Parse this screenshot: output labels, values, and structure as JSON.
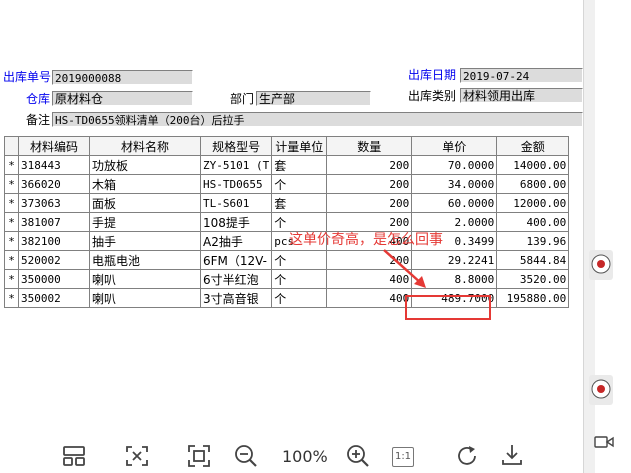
{
  "form": {
    "out_no_label": "出库单号",
    "out_no": "2019000088",
    "out_date_label": "出库日期",
    "out_date": "2019-07-24",
    "warehouse_label": "仓库",
    "warehouse": "原材料仓",
    "dept_label": "部门",
    "dept": "生产部",
    "out_type_label": "出库类别",
    "out_type": "材料领用出库",
    "remark_label": "备注",
    "remark": "HS-TD0655领料清单（200台）后拉手"
  },
  "table": {
    "headers": [
      "",
      "材料编码",
      "材料名称",
      "规格型号",
      "计量单位",
      "数量",
      "单价",
      "金额"
    ],
    "rows": [
      {
        "ind": "*",
        "code": "318443",
        "name": "功放板",
        "spec": "ZY-5101 (T",
        "unit": "套",
        "qty": "200",
        "price": "70.0000",
        "amount": "14000.00"
      },
      {
        "ind": "*",
        "code": "366020",
        "name": "木箱",
        "spec": "HS-TD0655",
        "unit": "个",
        "qty": "200",
        "price": "34.0000",
        "amount": "6800.00"
      },
      {
        "ind": "*",
        "code": "373063",
        "name": "面板",
        "spec": "TL-S601",
        "unit": "套",
        "qty": "200",
        "price": "60.0000",
        "amount": "12000.00"
      },
      {
        "ind": "*",
        "code": "381007",
        "name": "手提",
        "spec": "108提手",
        "unit": "个",
        "qty": "200",
        "price": "2.0000",
        "amount": "400.00"
      },
      {
        "ind": "*",
        "code": "382100",
        "name": "抽手",
        "spec": "A2抽手",
        "unit": "pcs",
        "qty": "400",
        "price": "0.3499",
        "amount": "139.96"
      },
      {
        "ind": "*",
        "code": "520002",
        "name": "电瓶电池",
        "spec": "6FM（12V-",
        "unit": "个",
        "qty": "200",
        "price": "29.2241",
        "amount": "5844.84"
      },
      {
        "ind": "*",
        "code": "350000",
        "name": "喇叭",
        "spec": "6寸半红泡",
        "unit": "个",
        "qty": "400",
        "price": "8.8000",
        "amount": "3520.00"
      },
      {
        "ind": "*",
        "code": "350002",
        "name": "喇叭",
        "spec": "3寸高音银",
        "unit": "个",
        "qty": "400",
        "price": "489.7000",
        "amount": "195880.00"
      }
    ]
  },
  "annotation": {
    "text": "这单价奇高，是怎么回事",
    "color": "#e53935"
  },
  "toolbar": {
    "zoom": "100%",
    "ratio_label": "1:1",
    "icons": [
      "layout-icon",
      "fit-width-icon",
      "fullscreen-icon",
      "zoom-out-icon",
      "zoom-in-icon",
      "actual-size-icon",
      "rotate-icon",
      "download-icon"
    ]
  }
}
